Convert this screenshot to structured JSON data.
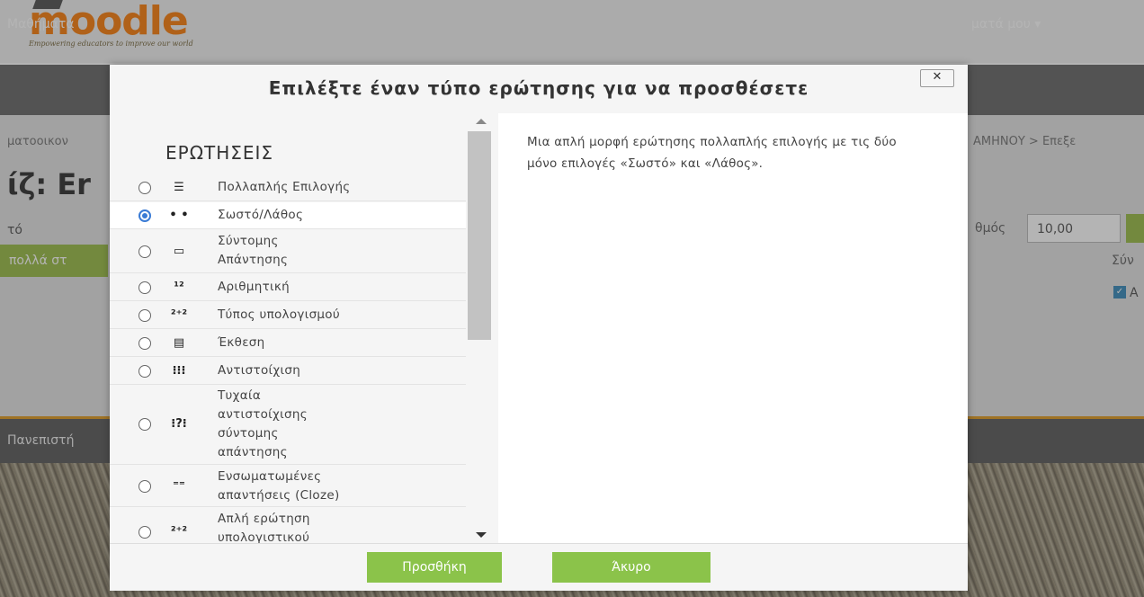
{
  "background": {
    "logo_text": "moodle",
    "logo_tagline": "Empowering educators to improve our world",
    "nav_left": "Μαθήματα",
    "nav_right": "ματά μου ▾",
    "breadcrumb_left": "ματοοικον",
    "breadcrumb_right": "ΑΜΗΝΟΥ > Επεξε",
    "page_title": "ίζ: Εr",
    "small_text": "τό",
    "green_button": "πολλά στ",
    "grade_label": "θμός",
    "grade_value": "10,00",
    "right_text": "Σύν",
    "checkbox_label": "Α",
    "footer_text": "Πανεπιστή"
  },
  "modal": {
    "title": "Επιλέξτε έναν τύπο ερώτησης για να προσθέσετε",
    "close_label": "✕",
    "section_title": "ΕΡΩΤΗΣΕΙΣ",
    "items": [
      {
        "label": "Πολλαπλής Επιλογής",
        "icon": "☰",
        "checked": false
      },
      {
        "label": "Σωστό/Λάθος",
        "icon": "• •",
        "checked": true
      },
      {
        "label": "Σύντομης Απάντησης",
        "icon": "▭",
        "checked": false
      },
      {
        "label": "Αριθμητική",
        "icon": "¹²",
        "checked": false
      },
      {
        "label": "Τύπος υπολογισμού",
        "icon": "²⁺²",
        "checked": false
      },
      {
        "label": "Έκθεση",
        "icon": "▤",
        "checked": false
      },
      {
        "label": "Αντιστοίχιση",
        "icon": "⁝⁝⁝",
        "checked": false
      },
      {
        "label": "Τυχαία αντιστοίχισης σύντομης απάντησης",
        "icon": "⁝?⁝",
        "checked": false
      },
      {
        "label": "Ενσωματωμένες απαντήσεις (Cloze)",
        "icon": "⁼⁼",
        "checked": false
      },
      {
        "label": "Απλή ερώτηση υπολογιστικού",
        "icon": "²⁺²",
        "checked": false
      }
    ],
    "description": "Μια απλή μορφή ερώτησης πολλαπλής επιλογής με τις δύο μόνο επιλογές «Σωστό» και «Λάθος».",
    "add_button": "Προσθήκη",
    "cancel_button": "Άκυρο"
  }
}
